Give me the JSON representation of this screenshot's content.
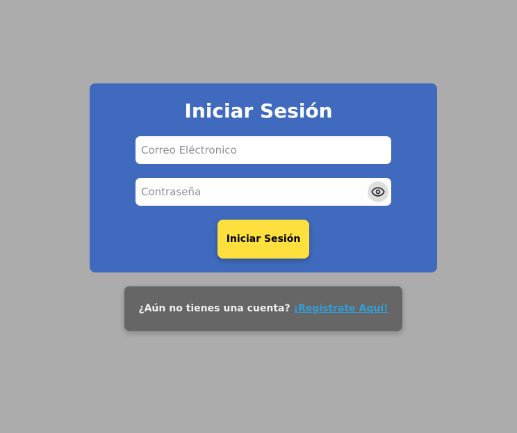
{
  "login": {
    "title": "Iniciar Sesión",
    "email_placeholder": "Correo Eléctronico",
    "password_placeholder": "Contraseña",
    "toggle_icon": "eye-icon",
    "submit_label": "Iniciar Sesión"
  },
  "register": {
    "prompt": "¿Aún no tienes una cuenta?",
    "link_label": "¡Registrate Aquí!"
  },
  "colors": {
    "background": "#acacac",
    "card": "#406abd",
    "button": "#fddf3d",
    "register_card": "#666666",
    "link": "#2f9fdc"
  }
}
